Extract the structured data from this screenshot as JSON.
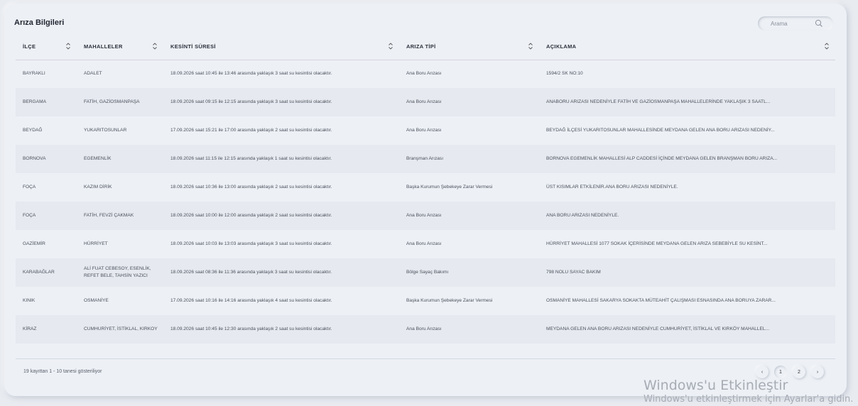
{
  "title": "Arıza Bilgileri",
  "search": {
    "placeholder": "Arama"
  },
  "columns": [
    "İLÇE",
    "MAHALLELER",
    "KESİNTİ SÜRESİ",
    "ARIZA TİPİ",
    "AÇIKLAMA"
  ],
  "rows": [
    [
      "BAYRAKLI",
      "ADALET",
      "18.09.2026 saat 10:45 ile 13:46 arasında yaklaşık 3 saat su kesintisi olacaktır.",
      "Ana Boru Arızası",
      "1594/2 SK NO:10"
    ],
    [
      "BERGAMA",
      "FATİH, GAZİOSMANPAŞA",
      "18.09.2026 saat 09:15 ile 12:15 arasında yaklaşık 3 saat su kesintisi olacaktır.",
      "Ana Boru Arızası",
      "ANABORU ARIZASI NEDENİYLE FATİH VE GAZİOSMANPAŞA MAHALLELERİNDE YAKLAŞIK 3 SAATL..."
    ],
    [
      "BEYDAĞ",
      "YUKARITOSUNLAR",
      "17.09.2026 saat 15:21 ile 17:00 arasında yaklaşık 2 saat su kesintisi olacaktır.",
      "Ana Boru Arızası",
      "BEYDAĞ İLÇESİ YUKARITOSUNLAR MAHALLESİNDE MEYDANA GELEN ANA BORU ARIZASI NEDENİY..."
    ],
    [
      "BORNOVA",
      "EGEMENLİK",
      "18.09.2026 saat 11:15 ile 12:15 arasında yaklaşık 1 saat su kesintisi olacaktır.",
      "Branşman Arızası",
      "BORNOVA EGEMENLİK MAHALLESİ ALP CADDESİ İÇİNDE MEYDANA GELEN BRANŞMAN BORU ARIZA..."
    ],
    [
      "FOÇA",
      "KAZIM DİRİK",
      "18.09.2026 saat 10:36 ile 13:00 arasında yaklaşık 2 saat su kesintisi olacaktır.",
      "Başka Kurumun Şebekeye Zarar Vermesi",
      "ÜST KISIMLAR ETKİLENİR.ANA BORU ARIZASI NEDENİYLE."
    ],
    [
      "FOÇA",
      "FATİH, FEVZİ ÇAKMAK",
      "18.09.2026 saat 10:00 ile 12:00 arasında yaklaşık 2 saat su kesintisi olacaktır.",
      "Ana Boru Arızası",
      "ANA BORU ARIZASI NEDENİYLE."
    ],
    [
      "GAZİEMİR",
      "HÜRRİYET",
      "18.09.2026 saat 10:03 ile 13:03 arasında yaklaşık 3 saat su kesintisi olacaktır.",
      "Ana Boru Arızası",
      "HÜRRİYET MAHALLESİ 1077 SOKAK İÇERİSİNDE MEYDANA GELEN ARIZA SEBEBİYLE SU KESİNT..."
    ],
    [
      "KARABAĞLAR",
      "ALİ FUAT CEBESOY, ESENLİK, REFET BELE, TAHSİN YAZICI",
      "18.09.2026 saat 08:36 ile 11:36 arasında yaklaşık 3 saat su kesintisi olacaktır.",
      "Bölge Sayaç Bakımı",
      "798 NOLU SAYAC BAKIM"
    ],
    [
      "KINIK",
      "OSMANİYE",
      "17.09.2026 saat 10:16 ile 14:16 arasında yaklaşık 4 saat su kesintisi olacaktır.",
      "Başka Kurumun Şebekeye Zarar Vermesi",
      "OSMANİYE MAHALLESİ SAKARYA SOKAKTA MÜTEAHİT ÇALIŞMASI ESNASINDA ANA BORUYA ZARAR..."
    ],
    [
      "KİRAZ",
      "CUMHURİYET, İSTİKLAL, KIRKOY",
      "18.09.2026 saat 10:45 ile 12:30 arasında yaklaşık 2 saat su kesintisi olacaktır.",
      "Ana Boru Arızası",
      "MEYDANA GELEN ANA BORU ARIZASI NEDENİYLE CUMHURİYET, İSTİKLAL VE KIRKÖY MAHALLEL..."
    ]
  ],
  "footer": "19 kayıttan 1 - 10 tanesi gösteriliyor",
  "pagination": {
    "prev": "‹",
    "pages": [
      "1",
      "2"
    ],
    "next": "›",
    "current": "1"
  },
  "watermark": {
    "line1": "Windows'u Etkinleştir",
    "line2": "Windows'u etkinleştirmek için Ayarlar'a gidin."
  }
}
